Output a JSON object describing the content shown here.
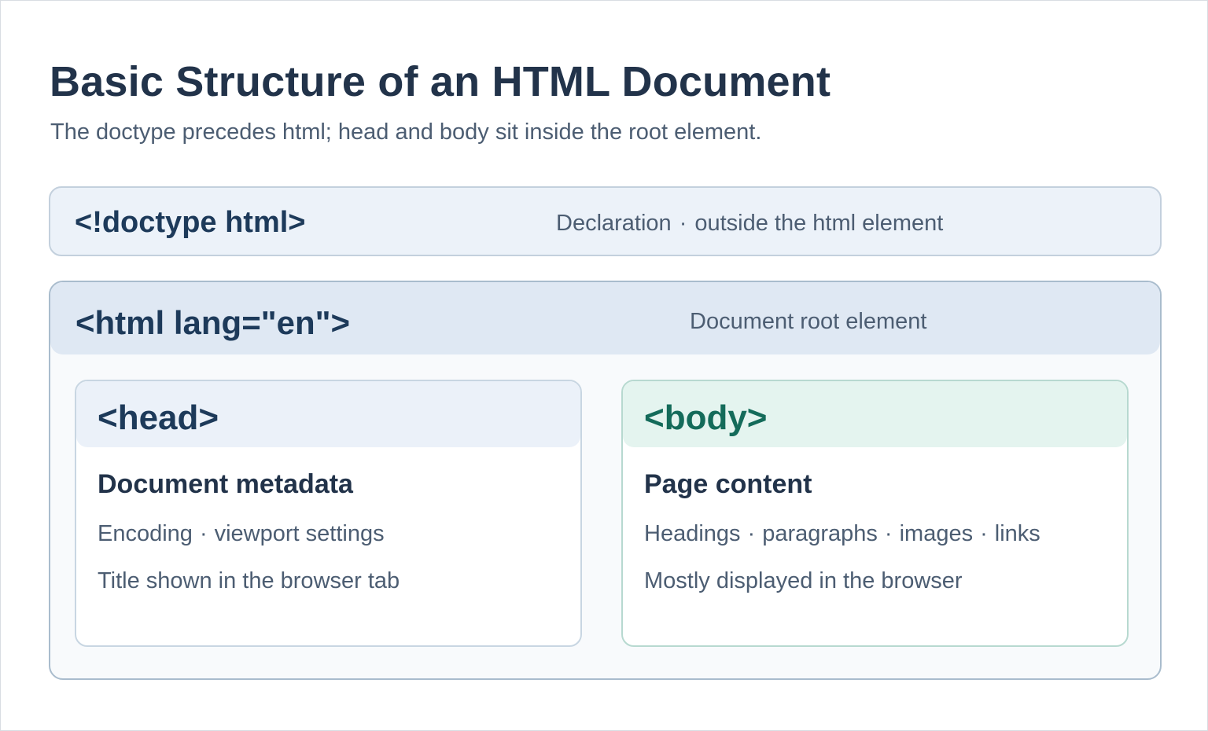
{
  "title": "Basic Structure of an HTML Document",
  "subtitle": "The doctype precedes html; head and body sit inside the root element.",
  "doctype": {
    "tag": "<!doctype html>",
    "note_a": "Declaration",
    "separator": "·",
    "note_b": "outside the html element"
  },
  "root": {
    "tag": "<html lang=\"en\">",
    "note": "Document root element"
  },
  "head": {
    "tag": "<head>",
    "heading": "Document metadata",
    "line1": [
      "Encoding",
      "viewport settings"
    ],
    "line2": "Title shown in the browser tab"
  },
  "body": {
    "tag": "<body>",
    "heading": "Page content",
    "line1": [
      "Headings",
      "paragraphs",
      "images",
      "links"
    ],
    "line2": "Mostly displayed in the browser"
  },
  "colors": {
    "title": "#22334a",
    "code_tag": "#1d3a5a",
    "body_tag": "#146b5a",
    "muted_text": "#4c5d72",
    "doctype_fill": "#ecf2f9",
    "root_header_fill": "#dfe8f3",
    "head_header_fill": "#ebf1f9",
    "body_header_fill": "#e4f4ef"
  }
}
